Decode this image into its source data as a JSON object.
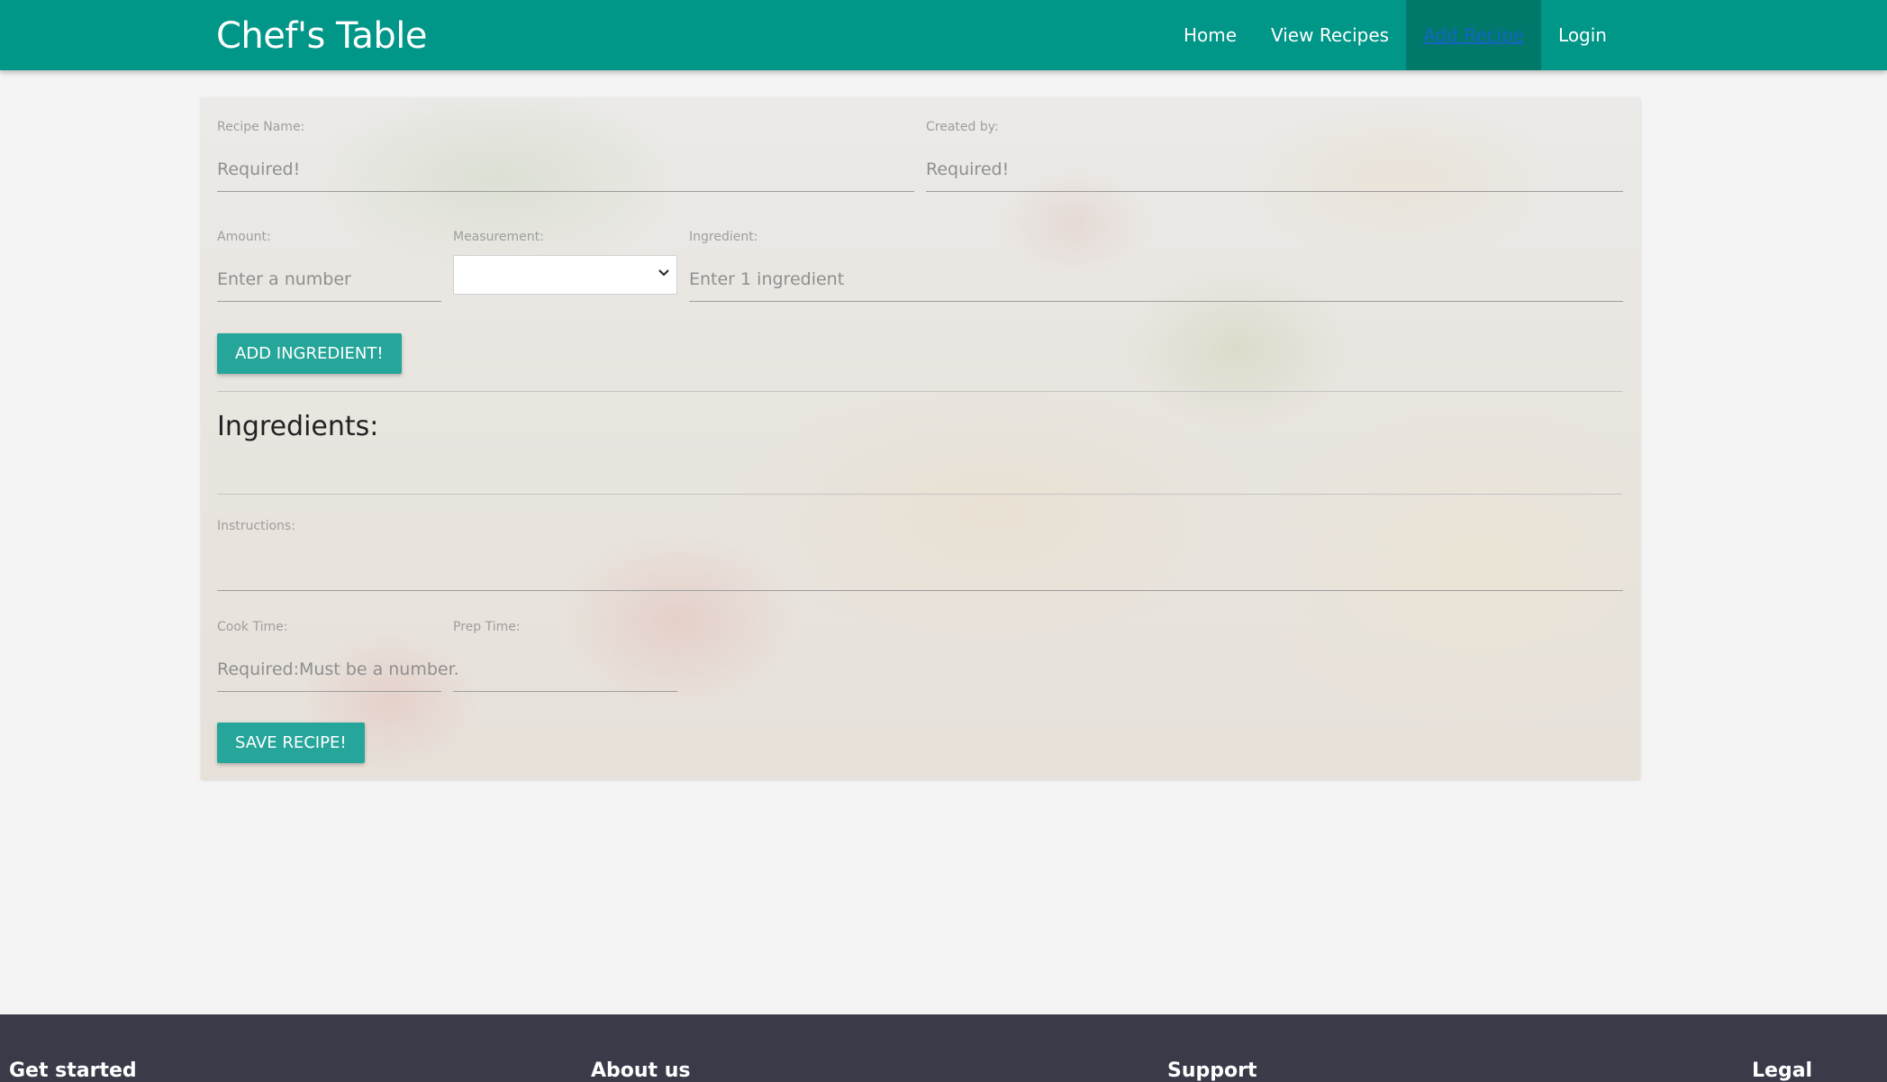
{
  "brand": "Chef's Table",
  "nav": {
    "home": "Home",
    "view_recipes": "View Recipes",
    "add_recipe": "Add Recipe",
    "login": "Login"
  },
  "form": {
    "recipe_name": {
      "label": "Recipe Name:",
      "placeholder": "Required!"
    },
    "created_by": {
      "label": "Created by:",
      "placeholder": "Required!"
    },
    "amount": {
      "label": "Amount:",
      "placeholder": "Enter a number"
    },
    "measurement": {
      "label": "Measurement:",
      "value": ""
    },
    "ingredient": {
      "label": "Ingredient:",
      "placeholder": "Enter 1 ingredient"
    },
    "add_ingredient_button": "ADD INGREDIENT!",
    "ingredients_heading": "Ingredients:",
    "instructions": {
      "label": "Instructions:",
      "placeholder": ""
    },
    "cook_time": {
      "label": "Cook Time:",
      "placeholder": "Required:Must be a number."
    },
    "prep_time": {
      "label": "Prep Time:",
      "placeholder": ""
    },
    "save_button": "SAVE RECIPE!"
  },
  "footer": {
    "get_started": "Get started",
    "about_us": "About us",
    "support": "Support",
    "legal": "Legal"
  },
  "colors": {
    "primary": "#009688",
    "active_nav": "#00796b",
    "button": "#26a69a",
    "footer": "#393b49"
  }
}
